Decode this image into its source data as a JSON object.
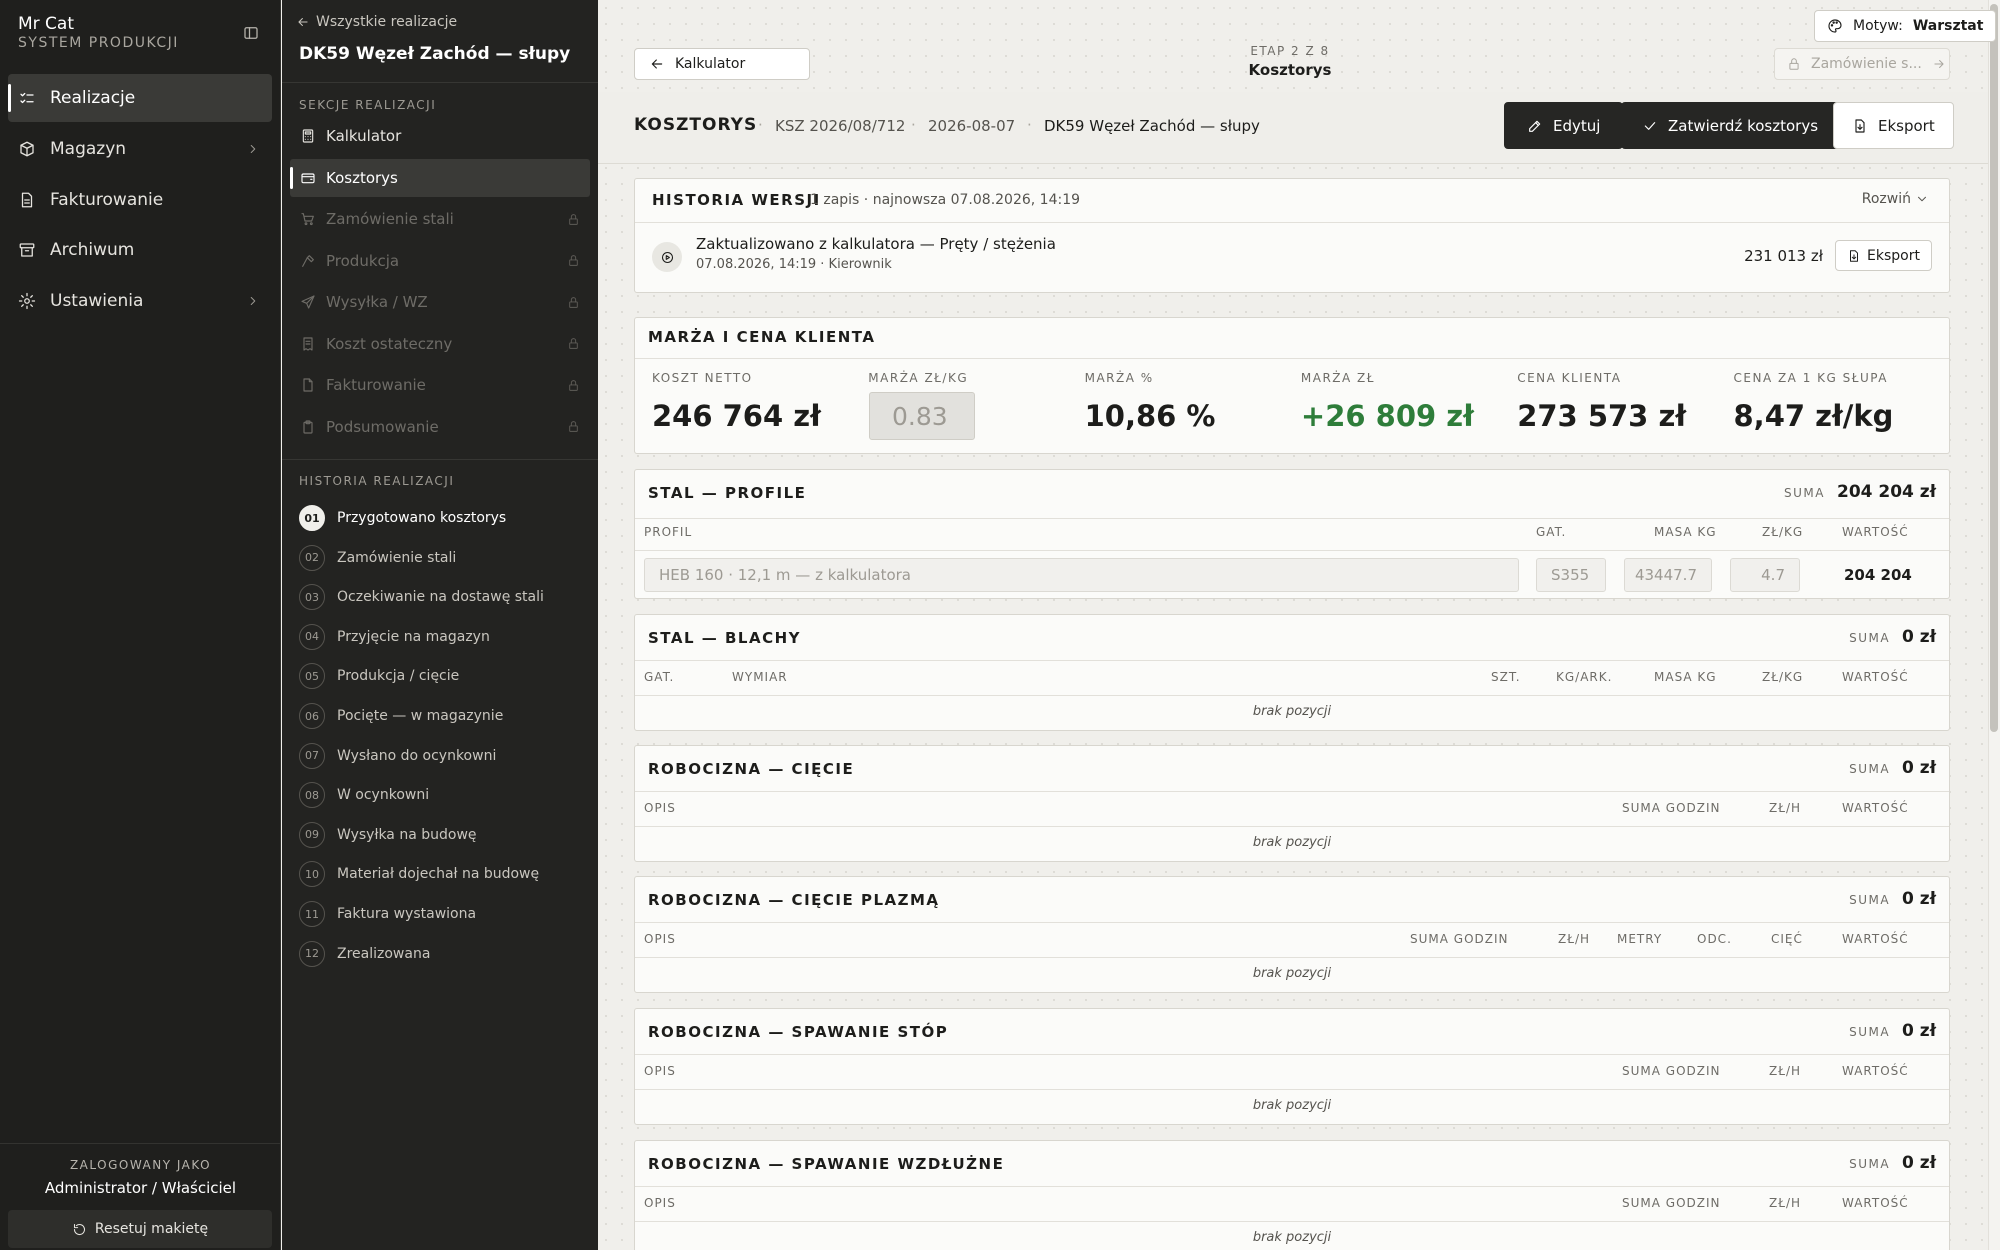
{
  "app": {
    "name": "Mr Cat",
    "subtitle": "SYSTEM PRODUKCJI"
  },
  "nav": {
    "items": [
      {
        "label": "Realizacje",
        "icon": "list-check-icon",
        "active": true
      },
      {
        "label": "Magazyn",
        "icon": "box-icon",
        "has_children": true
      },
      {
        "label": "Fakturowanie",
        "icon": "document-icon"
      },
      {
        "label": "Archiwum",
        "icon": "archive-icon"
      },
      {
        "label": "Ustawienia",
        "icon": "gear-icon",
        "has_children": true
      }
    ],
    "logged_caption": "ZALOGOWANY JAKO",
    "logged_user": "Administrator / Właściciel",
    "reset_label": "Resetuj makietę"
  },
  "panel": {
    "back_label": "Wszystkie realizacje",
    "project_title": "DK59 Węzeł Zachód — słupy",
    "sections_caption": "SEKCJE REALIZACJI",
    "sections": [
      {
        "label": "Kalkulator",
        "icon": "calculator-icon",
        "state": "open"
      },
      {
        "label": "Kosztorys",
        "icon": "wallet-icon",
        "state": "active"
      },
      {
        "label": "Zamówienie stali",
        "icon": "cart-icon",
        "state": "locked"
      },
      {
        "label": "Produkcja",
        "icon": "hammer-icon",
        "state": "locked"
      },
      {
        "label": "Wysyłka / WZ",
        "icon": "send-icon",
        "state": "locked"
      },
      {
        "label": "Koszt ostateczny",
        "icon": "receipt-icon",
        "state": "locked"
      },
      {
        "label": "Fakturowanie",
        "icon": "file-icon",
        "state": "locked"
      },
      {
        "label": "Podsumowanie",
        "icon": "clipboard-icon",
        "state": "locked"
      }
    ],
    "history_caption": "HISTORIA REALIZACJI",
    "history": [
      {
        "num": "01",
        "label": "Przygotowano kosztorys",
        "current": true
      },
      {
        "num": "02",
        "label": "Zamówienie stali"
      },
      {
        "num": "03",
        "label": "Oczekiwanie na dostawę stali"
      },
      {
        "num": "04",
        "label": "Przyjęcie na magazyn"
      },
      {
        "num": "05",
        "label": "Produkcja / cięcie"
      },
      {
        "num": "06",
        "label": "Pocięte — w magazynie"
      },
      {
        "num": "07",
        "label": "Wysłano do ocynkowni"
      },
      {
        "num": "08",
        "label": "W ocynkowni"
      },
      {
        "num": "09",
        "label": "Wysyłka na budowę"
      },
      {
        "num": "10",
        "label": "Materiał dojechał na budowę"
      },
      {
        "num": "11",
        "label": "Faktura wystawiona"
      },
      {
        "num": "12",
        "label": "Zrealizowana"
      }
    ]
  },
  "topbar": {
    "theme_label": "Motyw:",
    "theme_value": "Warsztat",
    "back_button": "Kalkulator",
    "step_caption": "ETAP 2 Z 8",
    "step_name": "Kosztorys",
    "next_button": "Zamówienie s..."
  },
  "header": {
    "title": "KOSZTORYS",
    "number": "KSZ 2026/08/712",
    "date": "2026-08-07",
    "project": "DK59 Węzeł Zachód — słupy",
    "edit_label": "Edytuj",
    "confirm_label": "Zatwierdź kosztorys",
    "export_label": "Eksport"
  },
  "version_history": {
    "title": "HISTORIA WERSJI",
    "meta": "1 zapis · najnowsza 07.08.2026, 14:19",
    "expand_label": "Rozwiń",
    "entries": [
      {
        "title": "Zaktualizowano z kalkulatora — Pręty / stężenia",
        "meta": "07.08.2026, 14:19 · Kierownik",
        "amount": "231 013 zł",
        "export_label": "Eksport"
      }
    ]
  },
  "margin": {
    "title": "MARŻA I CENA KLIENTA",
    "metrics": [
      {
        "label": "KOSZT NETTO",
        "value": "246 764 zł"
      },
      {
        "label": "MARŻA ZŁ/KG",
        "value": "0.83",
        "input": true
      },
      {
        "label": "MARŻA %",
        "value": "10,86 %"
      },
      {
        "label": "MARŻA ZŁ",
        "value": "+26 809 zł",
        "color": "#2e7d3a"
      },
      {
        "label": "CENA KLIENTA",
        "value": "273 573 zł"
      },
      {
        "label": "CENA ZA 1 KG SŁUPA",
        "value": "8,47 zł/kg"
      }
    ]
  },
  "sections": {
    "sum_caption": "SUMA",
    "empty_label": "brak pozycji",
    "profile": {
      "title": "STAL — PROFILE",
      "sum": "204 204 zł",
      "headers": [
        "PROFIL",
        "GAT.",
        "MASA KG",
        "ZŁ/KG",
        "WARTOŚĆ"
      ],
      "rows": [
        {
          "profile": "HEB 160 · 12,1 m — z kalkulatora",
          "grade": "S355",
          "mass": "43447.7",
          "price": "4.7",
          "value": "204 204"
        }
      ]
    },
    "sheets": {
      "title": "STAL — BLACHY",
      "sum": "0 zł",
      "headers": [
        "GAT.",
        "WYMIAR",
        "SZT.",
        "KG/ARK.",
        "MASA KG",
        "ZŁ/KG",
        "WARTOŚĆ"
      ]
    },
    "cutting": {
      "title": "ROBOCIZNA — CIĘCIE",
      "sum": "0 zł",
      "headers": [
        "OPIS",
        "SUMA GODZIN",
        "ZŁ/H",
        "WARTOŚĆ"
      ]
    },
    "plasma": {
      "title": "ROBOCIZNA — CIĘCIE PLAZMĄ",
      "sum": "0 zł",
      "headers": [
        "OPIS",
        "SUMA GODZIN",
        "ZŁ/H",
        "METRY",
        "ODC.",
        "CIĘĆ",
        "WARTOŚĆ"
      ]
    },
    "foot_weld": {
      "title": "ROBOCIZNA — SPAWANIE STÓP",
      "sum": "0 zł",
      "headers": [
        "OPIS",
        "SUMA GODZIN",
        "ZŁ/H",
        "WARTOŚĆ"
      ]
    },
    "long_weld": {
      "title": "ROBOCIZNA — SPAWANIE WZDŁUŻNE",
      "sum": "0 zł",
      "headers": [
        "OPIS",
        "SUMA GODZIN",
        "ZŁ/H",
        "WARTOŚĆ"
      ]
    }
  }
}
